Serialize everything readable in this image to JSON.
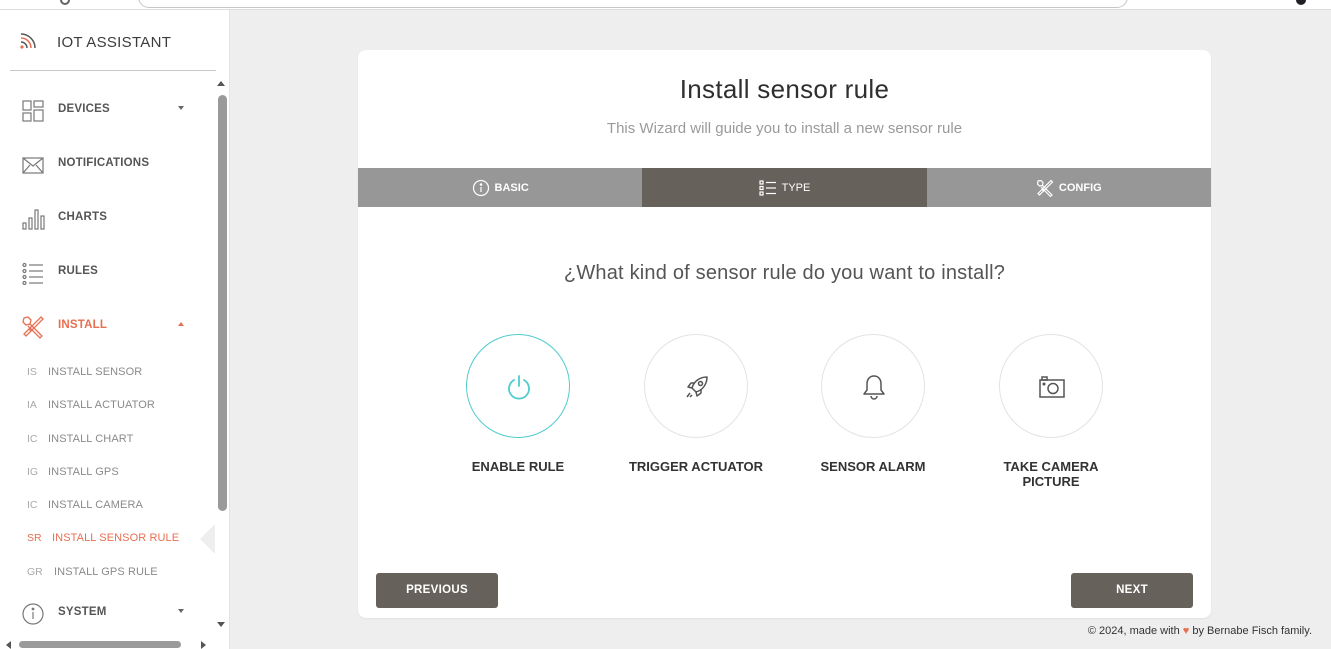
{
  "app": {
    "name": "IOT ASSISTANT"
  },
  "sidebar": {
    "items": [
      {
        "label": "DEVICES",
        "icon": "dashboard-icon",
        "expandable": true
      },
      {
        "label": "NOTIFICATIONS",
        "icon": "envelope-icon",
        "expandable": false
      },
      {
        "label": "CHARTS",
        "icon": "bar-chart-icon",
        "expandable": false
      },
      {
        "label": "RULES",
        "icon": "list-icon",
        "expandable": false
      },
      {
        "label": "INSTALL",
        "icon": "tools-icon",
        "expandable": true,
        "expanded": true
      },
      {
        "label": "SYSTEM",
        "icon": "info-icon",
        "expandable": true
      }
    ],
    "install_subitems": [
      {
        "abbr": "IS",
        "label": "INSTALL SENSOR"
      },
      {
        "abbr": "IA",
        "label": "INSTALL ACTUATOR"
      },
      {
        "abbr": "IC",
        "label": "INSTALL CHART"
      },
      {
        "abbr": "IG",
        "label": "INSTALL GPS"
      },
      {
        "abbr": "IC",
        "label": "INSTALL CAMERA"
      },
      {
        "abbr": "SR",
        "label": "INSTALL SENSOR RULE",
        "current": true
      },
      {
        "abbr": "GR",
        "label": "INSTALL GPS RULE"
      }
    ]
  },
  "wizard": {
    "title": "Install sensor rule",
    "subtitle": "This Wizard will guide you to install a new sensor rule",
    "tabs": [
      {
        "label": "BASIC",
        "icon": "info-icon"
      },
      {
        "label": "TYPE",
        "icon": "list-icon",
        "active": true
      },
      {
        "label": "CONFIG",
        "icon": "tools-icon"
      }
    ],
    "question": "¿What kind of sensor rule do you want to install?",
    "choices": [
      {
        "label": "ENABLE RULE",
        "icon": "power-icon",
        "selected": true
      },
      {
        "label": "TRIGGER ACTUATOR",
        "icon": "rocket-icon"
      },
      {
        "label": "SENSOR ALARM",
        "icon": "bell-icon"
      },
      {
        "label": "TAKE CAMERA PICTURE",
        "icon": "camera-icon"
      }
    ],
    "previous_label": "PREVIOUS",
    "next_label": "NEXT"
  },
  "footer": {
    "prefix": "© 2024, made with",
    "suffix": "by Bernabe Fisch family."
  },
  "colors": {
    "accent": "#e76f51",
    "selected": "#51cbce",
    "tab_active": "#66615b",
    "tab_inactive": "#979797",
    "button": "#66615b"
  }
}
